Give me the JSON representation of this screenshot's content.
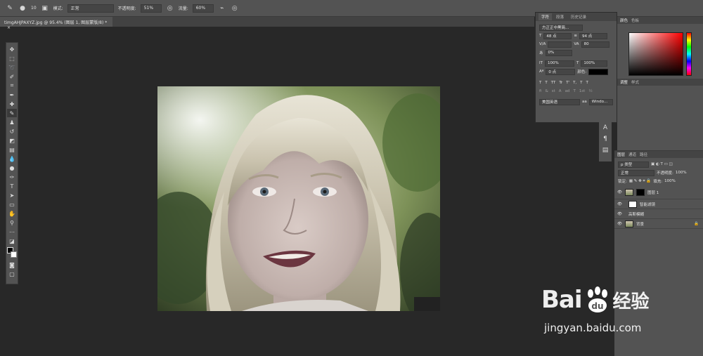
{
  "options_bar": {
    "brush_size": "10",
    "mode_label": "模式:",
    "mode_value": "正常",
    "opacity_label": "不透明度:",
    "opacity_value": "51%",
    "flow_label": "流量:",
    "flow_value": "60%"
  },
  "document_tab": {
    "title": "timgAHJPAXYZ.jpg @ 95.4% (图层 1, 图层蒙版/8) *",
    "close": "×"
  },
  "character_panel": {
    "tabs": [
      "字符",
      "段落",
      "历史记录"
    ],
    "font_family": "方正正中黑简...",
    "font_size": "48 点",
    "leading": "94 点",
    "kerning": "V/A",
    "tracking": "80",
    "scale_percent": "0%",
    "vertical_scale": "100%",
    "horizontal_scale": "100%",
    "baseline": "0 点",
    "color_label": "颜色:",
    "style_buttons": [
      "T",
      "T",
      "TT",
      "Tr",
      "T'",
      "T,",
      "T",
      "T"
    ],
    "opentype_buttons": [
      "fi",
      "&",
      "st",
      "A",
      "ad",
      "T",
      "1st",
      "½"
    ],
    "language": "美国英语",
    "aa_label": "aa",
    "antialias": "Windo..."
  },
  "right_dock": {
    "color_tabs": [
      "颜色",
      "色板"
    ],
    "adjust_tabs": [
      "调整",
      "样式"
    ]
  },
  "layers_panel": {
    "tabs": [
      "图层",
      "通道",
      "路径"
    ],
    "kind_filter": "p 类型",
    "blend_mode": "正常",
    "opacity_label": "不透明度:",
    "opacity_value": "100%",
    "lock_label": "锁定:",
    "fill_label": "填充:",
    "fill_value": "100%",
    "layers": [
      {
        "name": "图层 1"
      },
      {
        "name": "智能滤镜"
      },
      {
        "name": "高斯模糊"
      },
      {
        "name": "背景"
      }
    ]
  },
  "watermark": {
    "brand_left": "Bai",
    "brand_right": "经验",
    "url": "jingyan.baidu.com"
  },
  "colors": {
    "chrome": "#535353",
    "canvas_bg": "#282828",
    "accent": "#5a8fd6"
  }
}
